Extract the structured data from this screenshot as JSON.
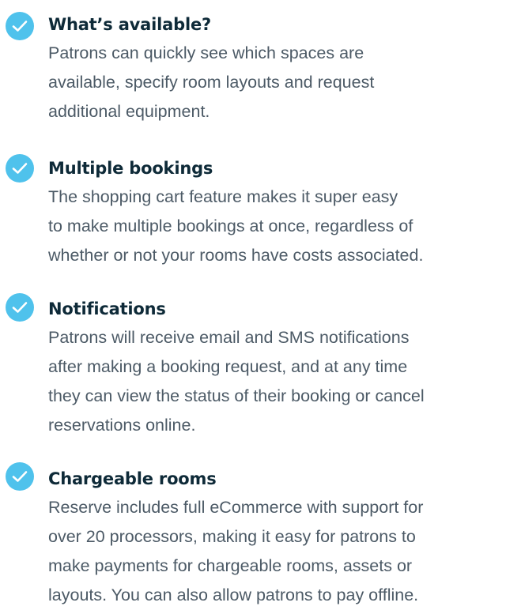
{
  "colors": {
    "check_bg": "#4fc2ec",
    "title": "#0e2a38",
    "body_text": "#4c5a66"
  },
  "features": [
    {
      "icon": "check-circle-icon",
      "title": "What’s available?",
      "lines": [
        "Patrons can quickly see which spaces are",
        "available, specify room layouts and request",
        "additional equipment."
      ]
    },
    {
      "icon": "check-circle-icon",
      "title": "Multiple bookings",
      "lines": [
        "The shopping cart feature makes it super easy",
        "to make multiple bookings at once, regardless of",
        "whether or not your rooms have costs associated."
      ]
    },
    {
      "icon": "check-circle-icon",
      "title": "Notifications",
      "lines": [
        "Patrons will receive email and SMS notifications",
        "after making a booking request, and at any time",
        "they can view the status of their booking or cancel",
        "reservations online."
      ]
    },
    {
      "icon": "check-circle-icon",
      "title": "Chargeable rooms",
      "lines": [
        "Reserve includes full eCommerce with support for",
        "over 20 processors, making it easy for patrons to",
        "make payments for chargeable rooms, assets or",
        "layouts. You can also allow patrons to pay offline."
      ]
    }
  ]
}
